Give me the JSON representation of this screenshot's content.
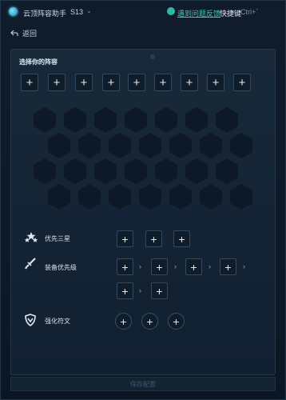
{
  "titlebar": {
    "app_title": "云顶阵容助手",
    "season": "S13",
    "feedback_link": "遇到问题反馈",
    "hotkey_label": "快捷键",
    "hotkey_value": "Ctrl+`"
  },
  "nav": {
    "back_label": "返回"
  },
  "lineup": {
    "title": "选择你的阵容",
    "slot_count": 9
  },
  "priority_star": {
    "label": "优先三星"
  },
  "equipment": {
    "label": "装备优先级"
  },
  "augment": {
    "label": "强化符文"
  },
  "confirm": {
    "label": "保存配置"
  },
  "colors": {
    "background": "#0c1724",
    "panel": "#142435",
    "accent": "#3fc7b5",
    "slot_border": "#304a63"
  },
  "icons": {
    "app": "app-logo-icon",
    "feedback": "feedback-icon",
    "back": "back-arrow-icon",
    "plus": "plus-icon",
    "stars": "three-stars-icon",
    "equipment": "sword-icon",
    "augment": "shield-rune-icon"
  }
}
